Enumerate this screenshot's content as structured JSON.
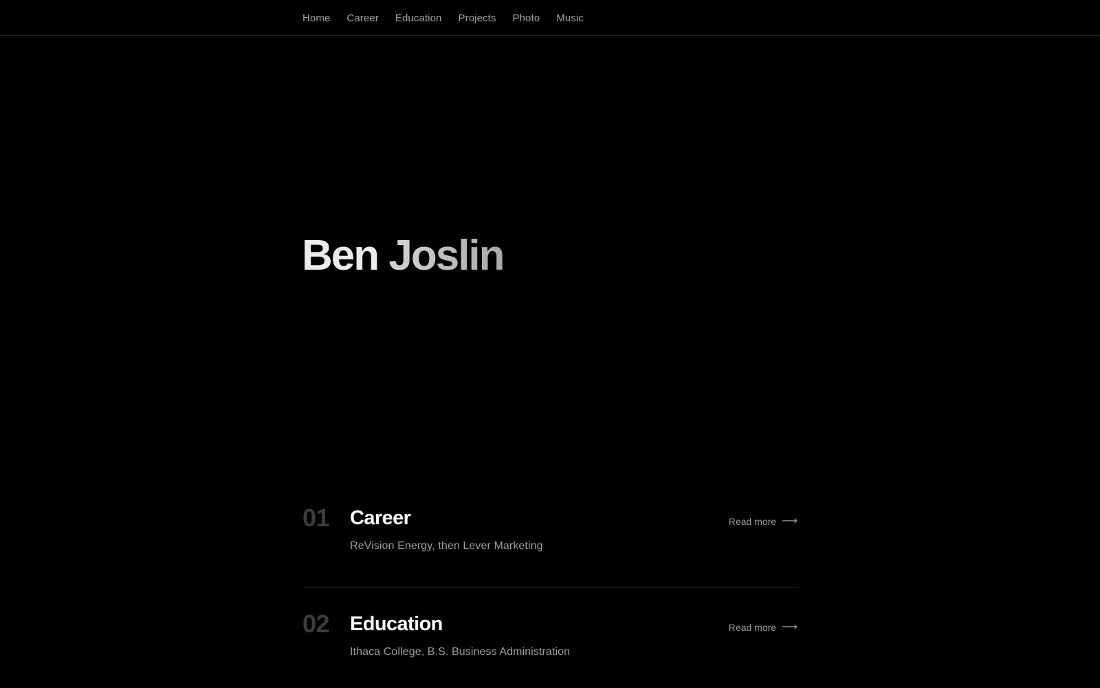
{
  "nav": {
    "items": [
      {
        "label": "Home"
      },
      {
        "label": "Career"
      },
      {
        "label": "Education"
      },
      {
        "label": "Projects"
      },
      {
        "label": "Photo"
      },
      {
        "label": "Music"
      }
    ]
  },
  "hero": {
    "first_name": "Ben",
    "last_name": "Joslin"
  },
  "sections": [
    {
      "number": "01",
      "title": "Career",
      "description": "ReVision Energy, then Lever Marketing",
      "link_label": "Read more",
      "link_icon": "arrow-right-icon"
    },
    {
      "number": "02",
      "title": "Education",
      "description": "Ithaca College, B.S. Business Administration",
      "link_label": "Read more",
      "link_icon": "arrow-right-icon"
    }
  ],
  "colors": {
    "background": "#000000",
    "nav_text": "#a3a3a3",
    "heading": "#ffffff",
    "muted_number": "#3d3d3d",
    "description": "#9d9d9d",
    "divider": "#1c1c1c"
  }
}
